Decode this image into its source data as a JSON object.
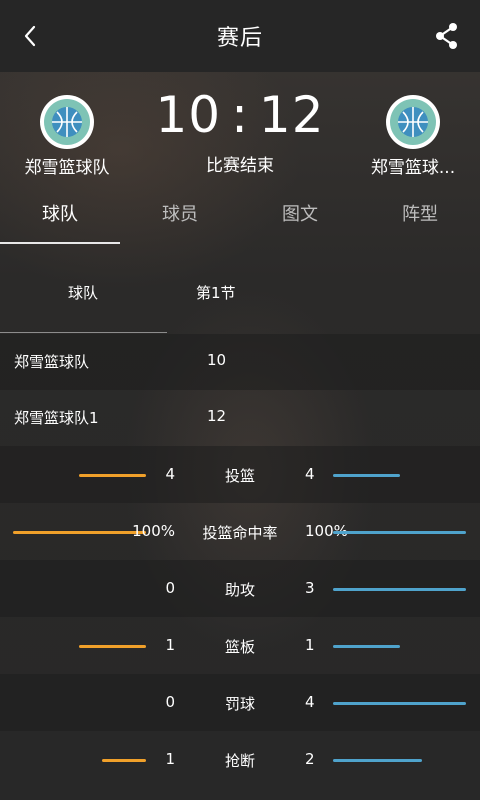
{
  "header": {
    "title": "赛后",
    "back_icon": "back-arrow-icon",
    "share_icon": "share-icon"
  },
  "match": {
    "home_team": "郑雪篮球队",
    "away_team": "郑雪篮球...",
    "home_score": "10",
    "separator": ":",
    "away_score": "12",
    "status": "比赛结束"
  },
  "tabs": [
    {
      "label": "球队",
      "active": true
    },
    {
      "label": "球员",
      "active": false
    },
    {
      "label": "图文",
      "active": false
    },
    {
      "label": "阵型",
      "active": false
    }
  ],
  "quarters": {
    "team_header": "球队",
    "period_header": "第1节",
    "rows": [
      {
        "team": "郑雪篮球队",
        "score": "10"
      },
      {
        "team": "郑雪篮球队1",
        "score": "12"
      }
    ]
  },
  "stats": [
    {
      "label": "投篮",
      "left": "4",
      "right": "4",
      "left_level": 0.5,
      "right_level": 0.5
    },
    {
      "label": "投篮命中率",
      "left": "100%",
      "right": "100%",
      "left_level": 1.0,
      "right_level": 1.0
    },
    {
      "label": "助攻",
      "left": "0",
      "right": "3",
      "left_level": 0.0,
      "right_level": 1.0
    },
    {
      "label": "篮板",
      "left": "1",
      "right": "1",
      "left_level": 0.5,
      "right_level": 0.5
    },
    {
      "label": "罚球",
      "left": "0",
      "right": "4",
      "left_level": 0.0,
      "right_level": 1.0
    },
    {
      "label": "抢断",
      "left": "1",
      "right": "2",
      "left_level": 0.33,
      "right_level": 0.67
    }
  ],
  "colors": {
    "home_bar": "#f0a02a",
    "away_bar": "#4fa3cc",
    "logo_ring": "#7ec3b5",
    "logo_core": "#3f8fbf"
  }
}
